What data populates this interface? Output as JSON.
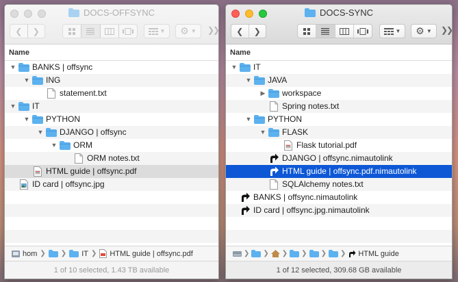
{
  "colors": {
    "folder": "#5cb1ef",
    "selection_active": "#0e58d6",
    "selection_inactive": "#dcdcdc"
  },
  "left_window": {
    "title": "DOCS-OFFSYNC",
    "column_header": "Name",
    "rows": [
      {
        "label": "BANKS | offsync",
        "icon": "folder-icon",
        "indent": 0,
        "disclosure": "open"
      },
      {
        "label": "ING",
        "icon": "folder-icon",
        "indent": 1,
        "disclosure": "open"
      },
      {
        "label": "statement.txt",
        "icon": "document-icon",
        "indent": 2,
        "disclosure": "none"
      },
      {
        "label": "IT",
        "icon": "folder-icon",
        "indent": 0,
        "disclosure": "open"
      },
      {
        "label": "PYTHON",
        "icon": "folder-icon",
        "indent": 1,
        "disclosure": "open"
      },
      {
        "label": "DJANGO | offsync",
        "icon": "folder-icon",
        "indent": 2,
        "disclosure": "open"
      },
      {
        "label": "ORM",
        "icon": "folder-icon",
        "indent": 3,
        "disclosure": "open"
      },
      {
        "label": "ORM notes.txt",
        "icon": "document-icon",
        "indent": 4,
        "disclosure": "none"
      },
      {
        "label": "HTML guide | offsync.pdf",
        "icon": "pdf-icon",
        "indent": 1,
        "disclosure": "none",
        "selected": "inactive"
      },
      {
        "label": "ID card | offsync.jpg",
        "icon": "image-icon",
        "indent": 0,
        "disclosure": "none"
      }
    ],
    "path": [
      "hom",
      "",
      "IT",
      "HTML guide | offsync.pdf"
    ],
    "status": "1 of 10 selected, 1.43 TB available"
  },
  "right_window": {
    "title": "DOCS-SYNC",
    "column_header": "Name",
    "rows": [
      {
        "label": "IT",
        "icon": "folder-icon",
        "indent": 0,
        "disclosure": "open"
      },
      {
        "label": "JAVA",
        "icon": "folder-icon",
        "indent": 1,
        "disclosure": "open"
      },
      {
        "label": "workspace",
        "icon": "folder-icon",
        "indent": 2,
        "disclosure": "closed"
      },
      {
        "label": "Spring notes.txt",
        "icon": "document-icon",
        "indent": 2,
        "disclosure": "none"
      },
      {
        "label": "PYTHON",
        "icon": "folder-icon",
        "indent": 1,
        "disclosure": "open"
      },
      {
        "label": "FLASK",
        "icon": "folder-icon",
        "indent": 2,
        "disclosure": "open"
      },
      {
        "label": "Flask tutorial.pdf",
        "icon": "pdf-icon",
        "indent": 3,
        "disclosure": "none"
      },
      {
        "label": "DJANGO | offsync.nimautolink",
        "icon": "alias-icon",
        "indent": 2,
        "disclosure": "none"
      },
      {
        "label": "HTML guide | offsync.pdf.nimautolink",
        "icon": "alias-icon",
        "indent": 2,
        "disclosure": "none",
        "selected": "active"
      },
      {
        "label": "SQLAlchemy notes.txt",
        "icon": "document-icon",
        "indent": 2,
        "disclosure": "none"
      },
      {
        "label": "BANKS | offsync.nimautolink",
        "icon": "alias-icon",
        "indent": 0,
        "disclosure": "none"
      },
      {
        "label": "ID card | offsync.jpg.nimautolink",
        "icon": "alias-icon",
        "indent": 0,
        "disclosure": "none"
      }
    ],
    "path_last": "HTML guide",
    "status": "1 of 12 selected, 309.68 GB available"
  }
}
